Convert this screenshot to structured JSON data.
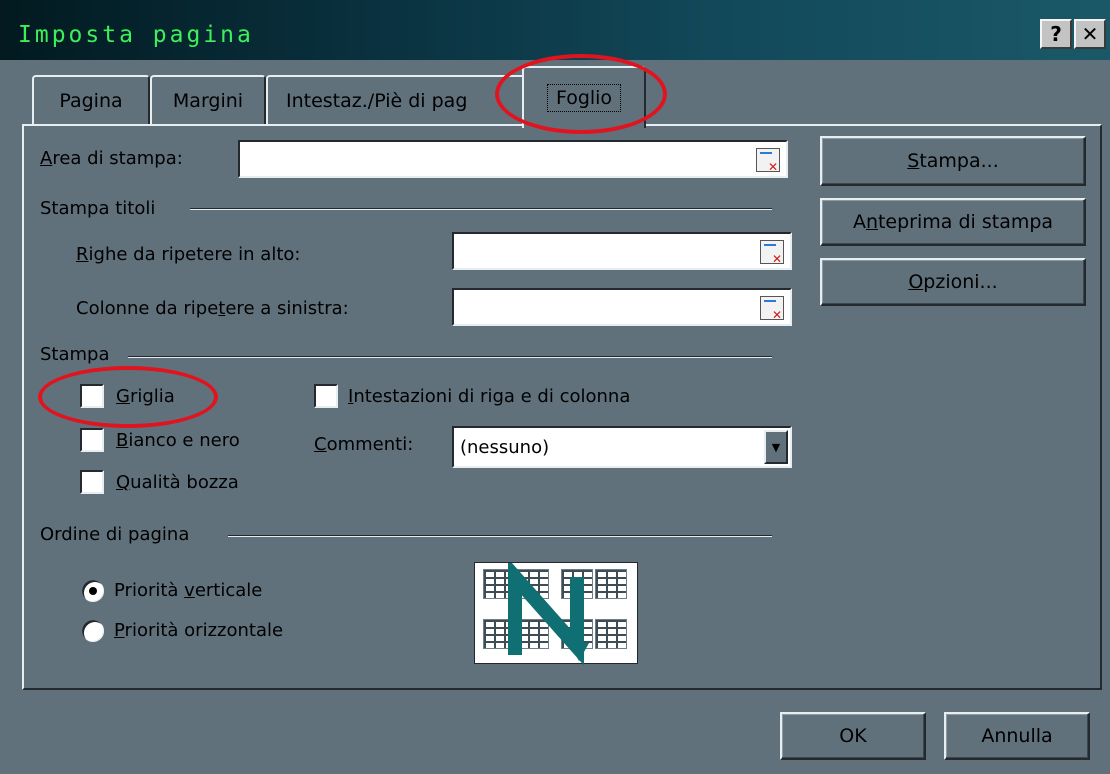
{
  "window": {
    "title": "Imposta pagina",
    "help_label": "?",
    "close_label": "✕"
  },
  "tabs": [
    {
      "label": "Pagina"
    },
    {
      "label": "Margini"
    },
    {
      "label": "Intestaz./Piè di pag"
    },
    {
      "label": "Foglio"
    }
  ],
  "print_area": {
    "label": "Area di stampa:",
    "value": ""
  },
  "titles": {
    "group_label": "Stampa titoli",
    "rows_label": "Righe da ripetere in alto:",
    "rows_value": "",
    "cols_label": "Colonne da ripetere a sinistra:",
    "cols_value": ""
  },
  "print": {
    "group_label": "Stampa",
    "gridlines": {
      "label": "Griglia",
      "checked": false
    },
    "bw": {
      "label": "Bianco e nero",
      "checked": false
    },
    "draft": {
      "label": "Qualità bozza",
      "checked": false
    },
    "headings": {
      "label": "Intestazioni di riga e di colonna",
      "checked": false
    },
    "comments_label": "Commenti:",
    "comments_value": "(nessuno)"
  },
  "order": {
    "group_label": "Ordine di pagina",
    "down_label": "Priorità verticale",
    "over_label": "Priorità orizzontale",
    "selected": "down"
  },
  "side_buttons": {
    "print": "Stampa...",
    "preview": "Anteprima di stampa",
    "options": "Opzioni..."
  },
  "footer": {
    "ok": "OK",
    "cancel": "Annulla"
  },
  "colors": {
    "dialog_face": "#61717c",
    "annotation_ring": "#e0141e",
    "title_text": "#3df05a"
  }
}
